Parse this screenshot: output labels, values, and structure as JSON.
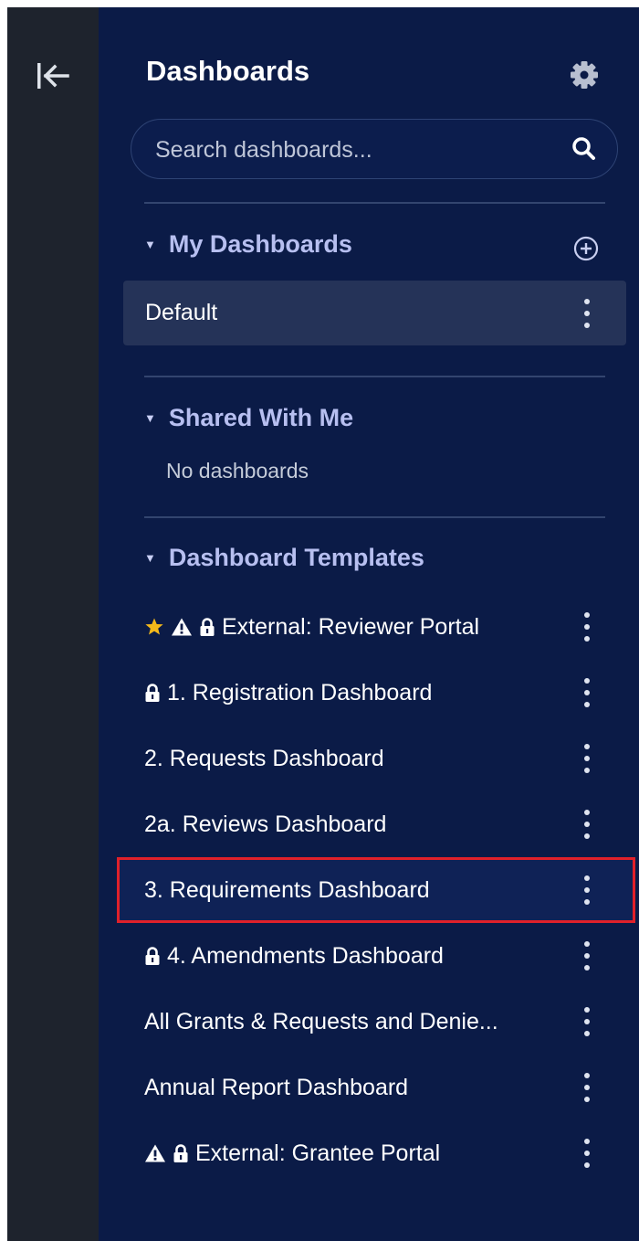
{
  "header": {
    "title": "Dashboards",
    "collapse_icon": "collapse-left-icon",
    "settings_icon": "gear-icon"
  },
  "search": {
    "placeholder": "Search dashboards...",
    "value": "",
    "icon": "search-icon"
  },
  "sections": {
    "my_dashboards": {
      "label": "My Dashboards",
      "add_icon": "plus-circle-icon",
      "items": [
        {
          "label": "Default",
          "selected": true
        }
      ]
    },
    "shared": {
      "label": "Shared With Me",
      "empty_text": "No dashboards"
    },
    "templates": {
      "label": "Dashboard Templates",
      "items": [
        {
          "label": "External: Reviewer Portal",
          "icons": [
            "star-icon",
            "warning-icon",
            "lock-icon"
          ]
        },
        {
          "label": "1. Registration Dashboard",
          "icons": [
            "lock-icon"
          ]
        },
        {
          "label": "2. Requests Dashboard",
          "icons": []
        },
        {
          "label": "2a. Reviews Dashboard",
          "icons": []
        },
        {
          "label": "3. Requirements Dashboard",
          "icons": [],
          "highlighted": true
        },
        {
          "label": "4. Amendments Dashboard",
          "icons": [
            "lock-icon"
          ]
        },
        {
          "label": "All Grants & Requests and Denie...",
          "icons": []
        },
        {
          "label": "Annual Report Dashboard",
          "icons": []
        },
        {
          "label": "External: Grantee Portal",
          "icons": [
            "warning-icon",
            "lock-icon"
          ]
        }
      ]
    }
  },
  "colors": {
    "rail": "#1e232d",
    "panel": "#0b1b47",
    "section_header": "#b7bff0",
    "selected_row": "#253358",
    "highlight_border": "#e0212a",
    "star": "#f5b91a"
  }
}
